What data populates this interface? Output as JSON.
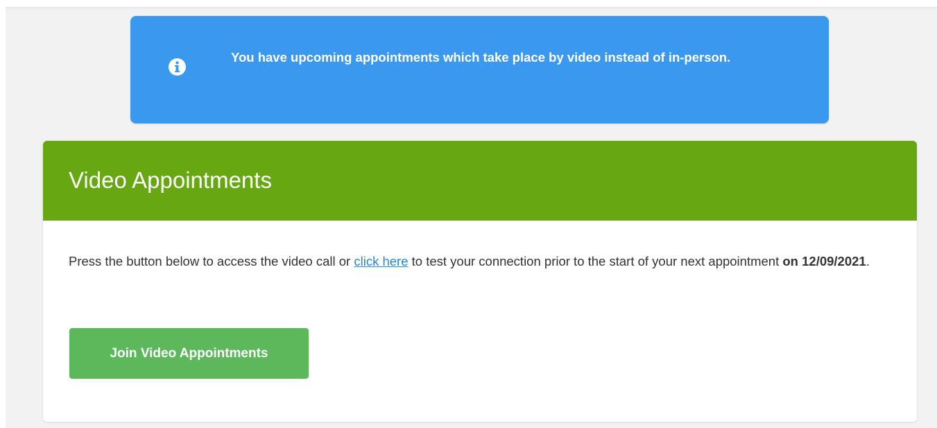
{
  "alert": {
    "icon": "info-icon",
    "message": "You have upcoming appointments which take place by video instead of in-person."
  },
  "card": {
    "title": "Video Appointments",
    "description": {
      "before_link": "Press the button below to access the video call or ",
      "link_text": "click here",
      "after_link": " to test your connection prior to the start of your next appointment ",
      "date_text": "on 12/09/2021",
      "end": "."
    },
    "join_button_label": "Join Video Appointments"
  },
  "colors": {
    "alert_bg": "#3a99ee",
    "header_bg": "#67a812",
    "button_bg": "#5db85c",
    "link": "#1f8ad8"
  }
}
